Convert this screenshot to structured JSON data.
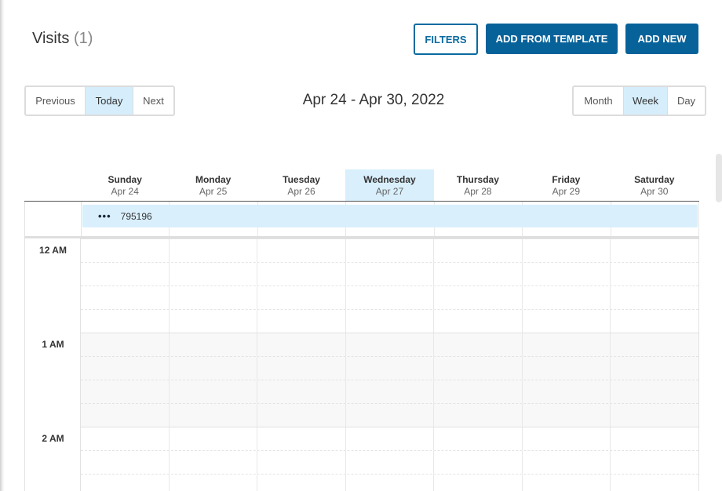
{
  "header": {
    "title": "Visits",
    "count": "(1)"
  },
  "actions": {
    "filters": "FILTERS",
    "add_template": "ADD FROM TEMPLATE",
    "add_new": "ADD NEW"
  },
  "nav": {
    "previous": "Previous",
    "today": "Today",
    "next": "Next"
  },
  "date_range": "Apr 24 - Apr 30, 2022",
  "views": {
    "month": "Month",
    "week": "Week",
    "day": "Day",
    "selected": "Week"
  },
  "days": [
    {
      "name": "Sunday",
      "date": "Apr 24"
    },
    {
      "name": "Monday",
      "date": "Apr 25"
    },
    {
      "name": "Tuesday",
      "date": "Apr 26"
    },
    {
      "name": "Wednesday",
      "date": "Apr 27",
      "today": true
    },
    {
      "name": "Thursday",
      "date": "Apr 28"
    },
    {
      "name": "Friday",
      "date": "Apr 29"
    },
    {
      "name": "Saturday",
      "date": "Apr 30"
    }
  ],
  "allday_event": {
    "menu_icon": "more-horizontal-icon",
    "label": "795196"
  },
  "time_labels": [
    "12 AM",
    "1 AM",
    "2 AM"
  ],
  "colors": {
    "primary": "#08629a",
    "today_highlight": "#d9effc",
    "active_segment": "#d6eefb"
  }
}
